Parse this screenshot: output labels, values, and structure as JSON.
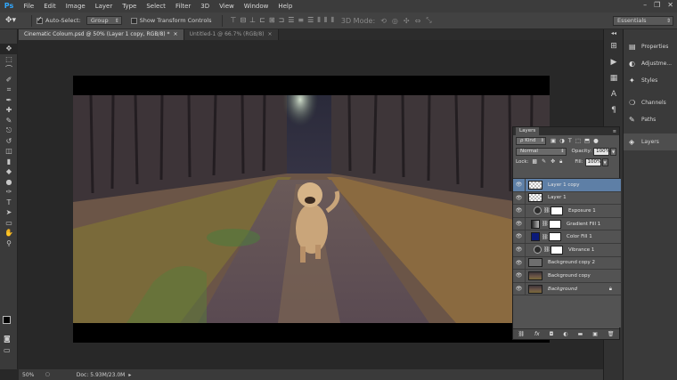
{
  "app": {
    "logo": "Ps"
  },
  "menu": [
    "File",
    "Edit",
    "Image",
    "Layer",
    "Type",
    "Select",
    "Filter",
    "3D",
    "View",
    "Window",
    "Help"
  ],
  "window_controls": [
    "–",
    "❐",
    "✕"
  ],
  "options": {
    "tool_icon": "move-tool-icon",
    "auto_select_label": "Auto-Select:",
    "auto_select_checked": true,
    "auto_select_mode": "Group",
    "transform_controls_label": "Show Transform Controls",
    "transform_controls_checked": false,
    "mode_3d_label": "3D Mode:",
    "workspace": "Essentials"
  },
  "document_tabs": [
    {
      "title": "Cinematic Coloum.psd @ 50% (Layer 1 copy, RGB/8) *",
      "close": "×",
      "active": true
    },
    {
      "title": "Untitled-1 @ 66.7% (RGB/8)",
      "close": "×",
      "active": false
    }
  ],
  "tools": [
    "move-tool-icon",
    "marquee-tool-icon",
    "lasso-tool-icon",
    "quick-select-tool-icon",
    "crop-tool-icon",
    "eyedropper-tool-icon",
    "healing-brush-tool-icon",
    "brush-tool-icon",
    "clone-stamp-tool-icon",
    "history-brush-tool-icon",
    "eraser-tool-icon",
    "gradient-tool-icon",
    "blur-tool-icon",
    "dodge-tool-icon",
    "pen-tool-icon",
    "type-tool-icon",
    "path-select-tool-icon",
    "shape-tool-icon",
    "hand-tool-icon",
    "zoom-tool-icon"
  ],
  "status": {
    "zoom": "50%",
    "doc": "Doc: 5.93M/23.0M"
  },
  "dock": {
    "panels": [
      {
        "label": "Properties",
        "icon": "properties-icon"
      },
      {
        "label": "Adjustme...",
        "icon": "adjustments-icon"
      },
      {
        "label": "Styles",
        "icon": "styles-icon"
      },
      {
        "label": "Channels",
        "icon": "channels-icon"
      },
      {
        "label": "Paths",
        "icon": "paths-icon"
      },
      {
        "label": "Layers",
        "icon": "layers-icon"
      }
    ]
  },
  "layers_panel": {
    "tab": "Layers",
    "filter_kind": "ρ Kind",
    "blend_mode": "Normal",
    "opacity_label": "Opacity:",
    "opacity": "100%",
    "lock_label": "Lock:",
    "fill_label": "Fill:",
    "fill": "100%",
    "layers": [
      {
        "name": "Layer 1 copy",
        "kind": "pixel-transparent",
        "selected": true
      },
      {
        "name": "Layer 1",
        "kind": "pixel-transparent",
        "selected": false
      },
      {
        "name": "Exposure 1",
        "kind": "adjustment",
        "thumb_color": "#3a3a3a",
        "selected": false
      },
      {
        "name": "Gradient Fill 1",
        "kind": "fill",
        "thumb_color": "#777777",
        "selected": false
      },
      {
        "name": "Color Fill 1",
        "kind": "fill",
        "thumb_color": "#0b1a7a",
        "selected": false
      },
      {
        "name": "Vibrance 1",
        "kind": "adjustment",
        "thumb_color": "#3a3a3a",
        "selected": false
      },
      {
        "name": "Background copy 2",
        "kind": "pixel",
        "thumb_color": "#6e6e6e",
        "selected": false
      },
      {
        "name": "Background copy",
        "kind": "photo",
        "selected": false
      },
      {
        "name": "Background",
        "kind": "photo",
        "locked": true,
        "italic": true,
        "selected": false
      }
    ],
    "footer_icons": [
      "link-layers-icon",
      "fx-icon",
      "add-mask-icon",
      "new-adjustment-icon",
      "new-group-icon",
      "new-layer-icon",
      "delete-layer-icon"
    ]
  },
  "colors": {
    "accent_selection": "#5e7fa6",
    "ps_blue": "#31a8ff"
  }
}
